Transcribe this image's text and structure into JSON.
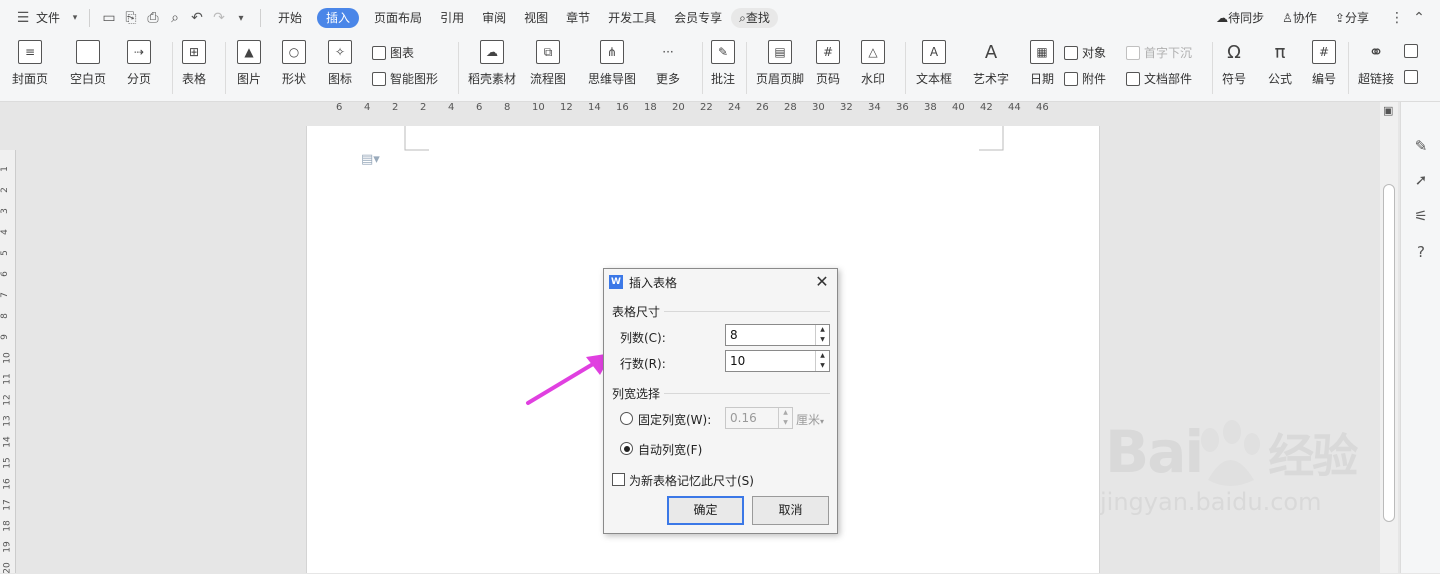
{
  "menubar": {
    "file": "文件",
    "tabs": [
      {
        "label": "开始"
      },
      {
        "label": "插入"
      },
      {
        "label": "页面布局"
      },
      {
        "label": "引用"
      },
      {
        "label": "审阅"
      },
      {
        "label": "视图"
      },
      {
        "label": "章节"
      },
      {
        "label": "开发工具"
      },
      {
        "label": "会员专享"
      }
    ],
    "search": "查找",
    "sync": "待同步",
    "collab": "协作",
    "share": "分享"
  },
  "ribbon": {
    "cover": "封面页",
    "blank": "空白页",
    "pagebreak": "分页",
    "table": "表格",
    "picture": "图片",
    "shape": "形状",
    "iconlib": "图标",
    "chart": "图表",
    "smartart": "智能图形",
    "material": "稻壳素材",
    "flowchart": "流程图",
    "mindmap": "思维导图",
    "more": "更多",
    "comment": "批注",
    "headerfooter": "页眉页脚",
    "pagenum": "页码",
    "watermark": "水印",
    "textbox": "文本框",
    "wordart": "艺术字",
    "date": "日期",
    "object": "对象",
    "attachment": "附件",
    "dropcap": "首字下沉",
    "docparts": "文档部件",
    "symbol": "符号",
    "formula": "公式",
    "numbering": "编号",
    "hyperlink": "超链接"
  },
  "ruler": {
    "h_ticks": [
      "6",
      "4",
      "2",
      "2",
      "4",
      "6",
      "8",
      "10",
      "12",
      "14",
      "16",
      "18",
      "20",
      "22",
      "24",
      "26",
      "28",
      "30",
      "32",
      "34",
      "36",
      "38",
      "40",
      "42",
      "44",
      "46"
    ],
    "v_ticks": [
      "1",
      "2",
      "3",
      "4",
      "5",
      "6",
      "7",
      "8",
      "9",
      "10",
      "11",
      "12",
      "13",
      "14",
      "15",
      "16",
      "17",
      "18",
      "19",
      "20"
    ]
  },
  "dialog": {
    "title": "插入表格",
    "group_size": "表格尺寸",
    "cols_label": "列数(C):",
    "cols_value": "8",
    "rows_label": "行数(R):",
    "rows_value": "10",
    "group_width": "列宽选择",
    "fixed_label": "固定列宽(W):",
    "fixed_value": "0.16",
    "fixed_unit": "厘米",
    "auto_label": "自动列宽(F)",
    "remember_label": "为新表格记忆此尺寸(S)",
    "ok": "确定",
    "cancel": "取消"
  },
  "watermark": {
    "brand": "Bai",
    "brand_cn": "经验",
    "url": "jingyan.baidu.com"
  },
  "colors": {
    "accent": "#4a86e8",
    "arrow": "#e040e0"
  }
}
